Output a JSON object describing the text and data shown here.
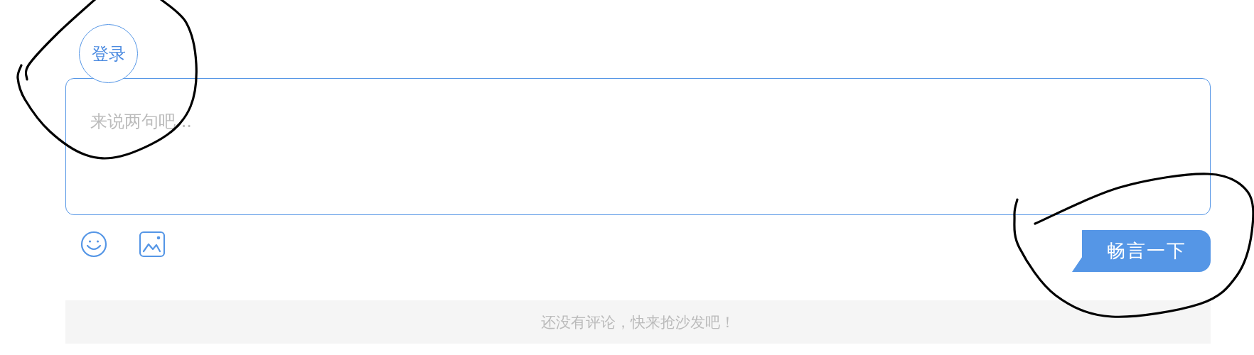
{
  "login_badge": {
    "label": "登录"
  },
  "comment_box": {
    "placeholder": "来说两句吧..."
  },
  "toolbar": {
    "icons": [
      {
        "kind": "emoji"
      },
      {
        "kind": "image"
      }
    ]
  },
  "submit_button": {
    "label": "畅言一下"
  },
  "empty_notice": "还没有评论，快来抢沙发吧！"
}
